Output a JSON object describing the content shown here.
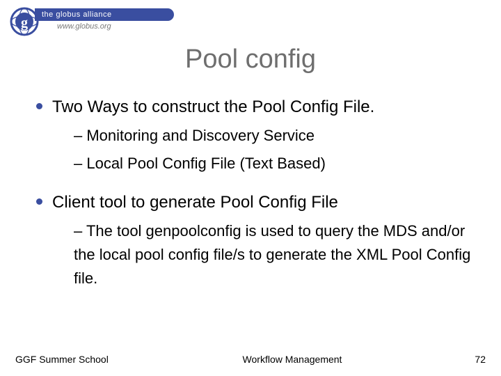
{
  "logo": {
    "band_text": "the globus alliance",
    "sub_text": "www.globus.org"
  },
  "title": "Pool config",
  "bullets": [
    {
      "text": "Two Ways to construct the Pool Config File.",
      "children": [
        "– Monitoring and Discovery Service",
        "– Local Pool Config File (Text Based)"
      ]
    },
    {
      "text": "Client tool to generate Pool Config File",
      "children": [
        "– The tool genpoolconfig is used to query the MDS and/or the local pool config file/s to generate the XML Pool Config file."
      ]
    }
  ],
  "footer": {
    "left": "GGF Summer School",
    "center": "Workflow Management",
    "right": "72"
  }
}
